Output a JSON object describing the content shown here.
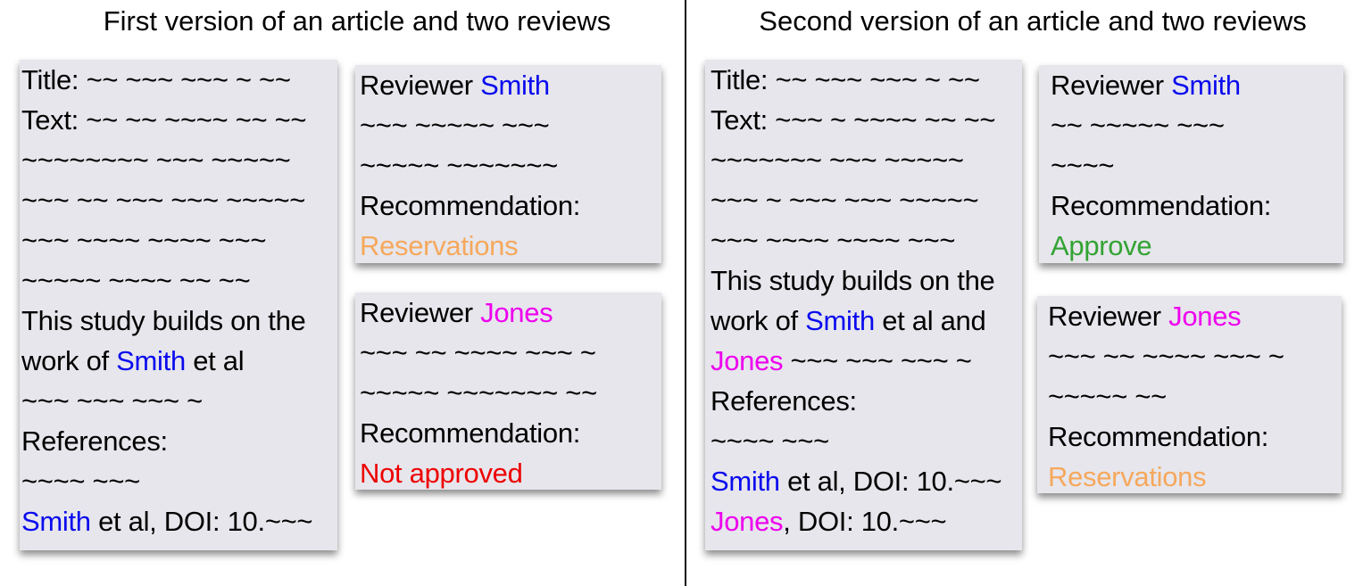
{
  "colors": {
    "smith": "#0a0aee",
    "jones": "#ee00ee",
    "reservations": "#f6a85c",
    "not_approved": "#ee0000",
    "approve": "#33a333",
    "card_bg": "#e6e6ec"
  },
  "v1": {
    "heading": "First version of an article and two reviews",
    "article": {
      "title_label": "Title:",
      "title_value": "~~ ~~~ ~~~ ~ ~~",
      "text_label": "Text:",
      "text_line1": "~~  ~~  ~~~~ ~~ ~~",
      "body_lines": [
        "~~~~~~~~ ~~~  ~~~~~",
        "~~~ ~~ ~~~ ~~~ ~~~~~",
        "~~~   ~~~~    ~~~~    ~~~",
        "~~~~~    ~~~~ ~~ ~~"
      ],
      "study_line1": "This study builds on the",
      "study_prefix": "work of ",
      "smith": "Smith",
      "study_suffix": " et al",
      "tilde_after": "~~~  ~~~ ~~~  ~",
      "references_label": "References:",
      "ref_tilde": "~~~~  ~~~",
      "ref1_name": "Smith",
      "ref1_rest": " et al, DOI: 10.~~~"
    },
    "review_smith": {
      "reviewer_label": "Reviewer ",
      "name": "Smith",
      "lines": [
        "~~~   ~~~~~  ~~~",
        "~~~~~ ~~~~~~~"
      ],
      "rec_label": "Recommendation:",
      "rec_value": "Reservations"
    },
    "review_jones": {
      "reviewer_label": "Reviewer ",
      "name": "Jones",
      "lines": [
        "~~~   ~~  ~~~~ ~~~ ~",
        "~~~~~ ~~~~~~~ ~~"
      ],
      "rec_label": "Recommendation:",
      "rec_value": "Not approved"
    }
  },
  "v2": {
    "heading": "Second version of an article and two reviews",
    "article": {
      "title_label": "Title:",
      "title_value": "~~ ~~~ ~~~ ~ ~~",
      "text_label": "Text:",
      "text_line1": "~~~ ~  ~~~~ ~~ ~~",
      "body_lines": [
        "~~~~~~~ ~~~  ~~~~~",
        "~~~ ~ ~~~ ~~~ ~~~~~",
        "~~~   ~~~~    ~~~~    ~~~"
      ],
      "study_line1": "This study builds on the",
      "study_prefix": "work of ",
      "smith": "Smith",
      "study_mid": " et al and",
      "jones": "Jones",
      "jones_suffix": " ~~~  ~~~ ~~~  ~",
      "references_label": "References:",
      "ref_tilde": "~~~~  ~~~",
      "ref1_name": "Smith",
      "ref1_rest": " et al, DOI: 10.~~~",
      "ref2_name": "Jones",
      "ref2_rest": ", DOI: 10.~~~"
    },
    "review_smith": {
      "reviewer_label": "Reviewer ",
      "name": "Smith",
      "lines": [
        "~~  ~~~~~  ~~~",
        "~~~~"
      ],
      "rec_label": "Recommendation:",
      "rec_value": "Approve"
    },
    "review_jones": {
      "reviewer_label": "Reviewer ",
      "name": "Jones",
      "lines": [
        "~~~   ~~  ~~~~ ~~~ ~",
        "~~~~~ ~~"
      ],
      "rec_label": "Recommendation:",
      "rec_value": "Reservations"
    }
  }
}
